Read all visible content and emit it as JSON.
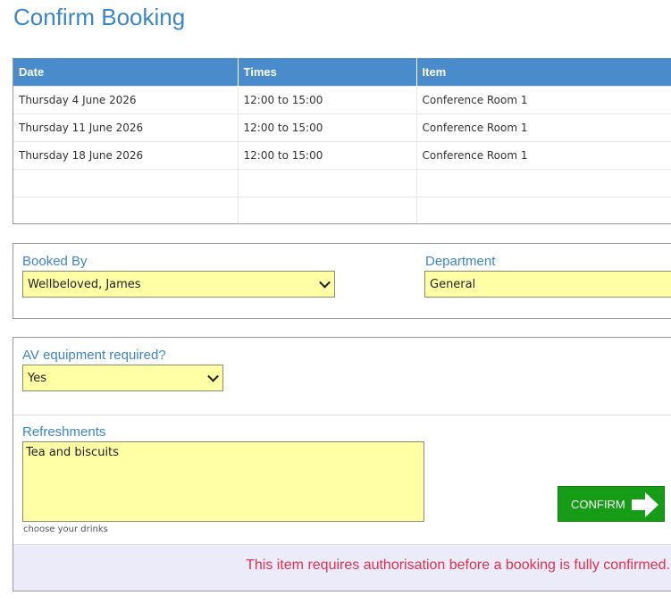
{
  "page": {
    "title": "Confirm Booking"
  },
  "table": {
    "headers": [
      "Date",
      "Times",
      "Item"
    ],
    "rows": [
      [
        "Thursday 4 June 2026",
        "12:00 to 15:00",
        "Conference Room 1"
      ],
      [
        "Thursday 11 June 2026",
        "12:00 to 15:00",
        "Conference Room 1"
      ],
      [
        "Thursday 18 June 2026",
        "12:00 to 15:00",
        "Conference Room 1"
      ],
      [
        "",
        "",
        ""
      ],
      [
        "",
        "",
        ""
      ]
    ]
  },
  "booker": {
    "booked_by_label": "Booked By",
    "booked_by_value": "Wellbeloved, James",
    "department_label": "Department",
    "department_value": "General"
  },
  "extras": {
    "av_label": "AV equipment required?",
    "av_value": "Yes",
    "refreshments_label": "Refreshments",
    "refreshments_value": "Tea and biscuits",
    "refreshments_hint": "choose your drinks"
  },
  "confirm": {
    "label": "CONFIRM"
  },
  "notice": {
    "text": "This item requires authorisation before a booking is fully confirmed."
  },
  "colors": {
    "accent": "#3d86c6",
    "header_bg": "#4a8bcb",
    "field_bg": "#ffffa6",
    "confirm_bg": "#179c17",
    "notice_text": "#e0314e",
    "notice_bg": "#ebebfa"
  }
}
